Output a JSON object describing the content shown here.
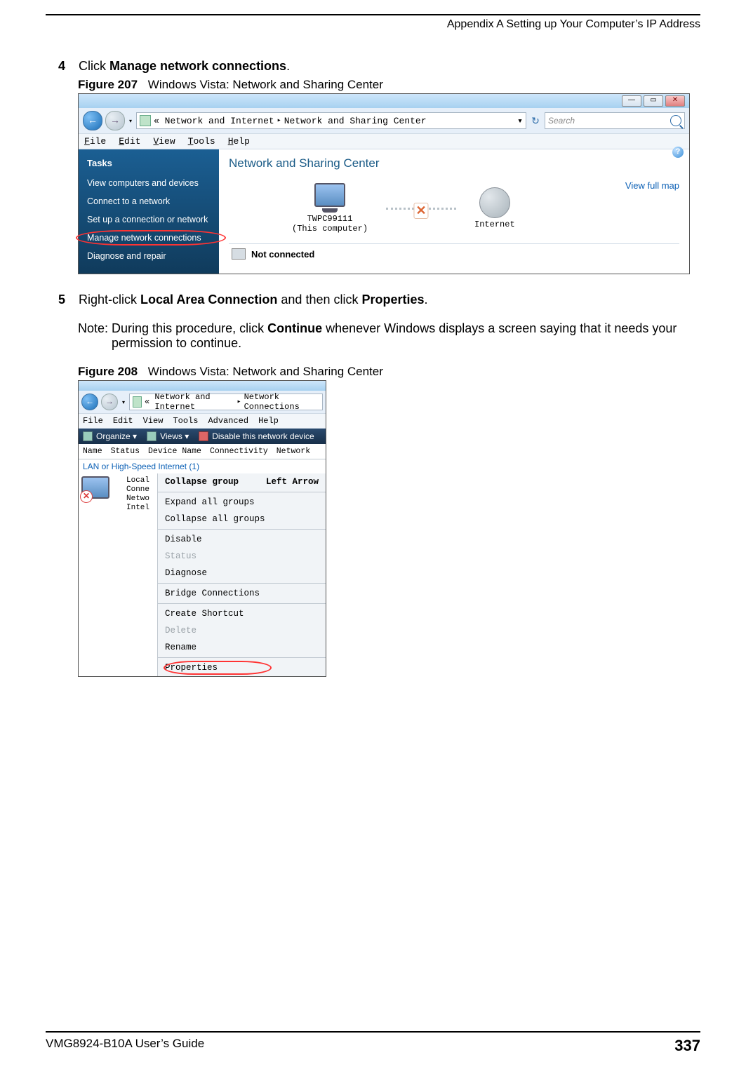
{
  "header": {
    "appendix_title": "Appendix A Setting up Your Computer’s IP Address"
  },
  "steps": {
    "s4": {
      "num": "4",
      "pre": "Click ",
      "bold": "Manage network connections",
      "post": "."
    },
    "s5": {
      "num": "5",
      "pre": "Right-click ",
      "b1": "Local Area Connection",
      "mid": " and then click ",
      "b2": "Properties",
      "post": "."
    }
  },
  "note": {
    "label": "Note: ",
    "t1": "During this procedure, click ",
    "b1": "Continue",
    "t2": " whenever Windows displays a screen saying that it needs your permission to continue."
  },
  "figures": {
    "f207": {
      "num": "Figure 207",
      "title": "Windows Vista: Network and Sharing Center"
    },
    "f208": {
      "num": "Figure 208",
      "title": "Windows Vista: Network and Sharing Center"
    }
  },
  "win1": {
    "titlebar_buttons": {
      "min": "—",
      "max": "▭",
      "close": "✕"
    },
    "nav": {
      "back": "←",
      "fwd": "→",
      "dd": "▾"
    },
    "crumbs": {
      "laquo": "«",
      "c1": "Network and Internet",
      "c2": "Network and Sharing Center",
      "sep": "▸",
      "crumbdd": "▾"
    },
    "refresh": "↻",
    "search_placeholder": "Search",
    "menu": [
      "File",
      "Edit",
      "View",
      "Tools",
      "Help"
    ],
    "help_glyph": "?",
    "tasks_header": "Tasks",
    "tasks": [
      "View computers and devices",
      "Connect to a network",
      "Set up a connection or network",
      "Manage network connections",
      "Diagnose and repair"
    ],
    "content_title": "Network and Sharing Center",
    "view_full_map": "View full map",
    "node1_name": "TWPC99111",
    "node1_sub": "(This computer)",
    "node2_name": "Internet",
    "linkx": "✕",
    "not_connected": "Not connected"
  },
  "win2": {
    "crumbs": {
      "laquo": "«",
      "c1": "Network and Internet",
      "c2": "Network Connections",
      "sep": "▸"
    },
    "menu": [
      "File",
      "Edit",
      "View",
      "Tools",
      "Advanced",
      "Help"
    ],
    "toolbar": {
      "organize": "Organize  ▾",
      "views": "Views   ▾",
      "disable": "Disable this network device"
    },
    "columns": [
      "Name",
      "Status",
      "Device Name",
      "Connectivity",
      "Network"
    ],
    "group_header": "LAN or High-Speed Internet (1)",
    "icon_label_lines": [
      "Local",
      "Conne",
      "Netwo",
      "Intel"
    ],
    "icon_x": "✕",
    "ctx": {
      "collapse_group": "Collapse group",
      "left_arrow": "Left Arrow",
      "expand_all": "Expand all groups",
      "collapse_all": "Collapse all groups",
      "disable": "Disable",
      "status": "Status",
      "diagnose": "Diagnose",
      "bridge": "Bridge Connections",
      "shortcut": "Create Shortcut",
      "delete": "Delete",
      "rename": "Rename",
      "properties": "Properties"
    }
  },
  "footer": {
    "guide": "VMG8924-B10A User’s Guide",
    "page": "337"
  }
}
